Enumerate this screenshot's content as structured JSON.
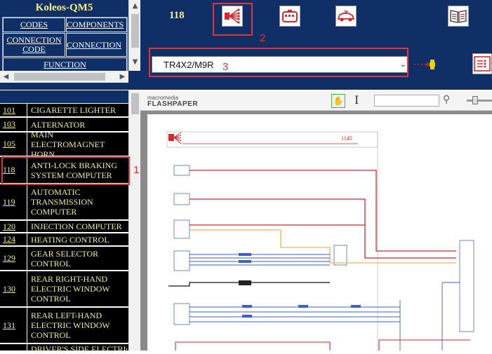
{
  "app": {
    "title": "Koleos-QM5"
  },
  "nav": {
    "codes": "CODES",
    "components": "COMPONENTS",
    "connection_code": "CONNECTION CODE",
    "connection": "CONNECTION",
    "function": "FUNCTION"
  },
  "list": [
    {
      "num": "101",
      "label": "CIGARETTE LIGHTER"
    },
    {
      "num": "103",
      "label": "ALTERNATOR"
    },
    {
      "num": "105",
      "label": "MAIN ELECTROMAGNET HORN"
    },
    {
      "num": "118",
      "label": "ANTI-LOCK BRAKING SYSTEM COMPUTER"
    },
    {
      "num": "119",
      "label": "AUTOMATIC TRANSMISSION COMPUTER"
    },
    {
      "num": "120",
      "label": "INJECTION COMPUTER"
    },
    {
      "num": "124",
      "label": "HEATING CONTROL"
    },
    {
      "num": "129",
      "label": "GEAR SELECTOR CONTROL"
    },
    {
      "num": "130",
      "label": "REAR RIGHT-HAND ELECTRIC WINDOW CONTROL"
    },
    {
      "num": "131",
      "label": "REAR LEFT-HAND ELECTRIC WINDOW CONTROL"
    },
    {
      "num": "",
      "label": "DRIVER'S SIDE ELECTRIC"
    }
  ],
  "toolbar": {
    "component_number": "118",
    "selected_connection": "TR4X2/M9R"
  },
  "annotations": {
    "one": "1",
    "two": "2",
    "three": "3"
  },
  "viewer": {
    "logo_top": "macromedia",
    "logo_bottom": "FLASHPAPER"
  },
  "diagram": {
    "ref": "1145"
  },
  "colors": {
    "nav_bg": "#0f2f66",
    "label_yellow": "#f3ee8c",
    "annotation_red": "#e0353a"
  },
  "icons": [
    "connector-pins-icon",
    "connector-block-icon",
    "vehicle-icon",
    "book-icon",
    "add-connection-icon",
    "hand-tool-icon",
    "text-select-icon",
    "search-icon"
  ]
}
